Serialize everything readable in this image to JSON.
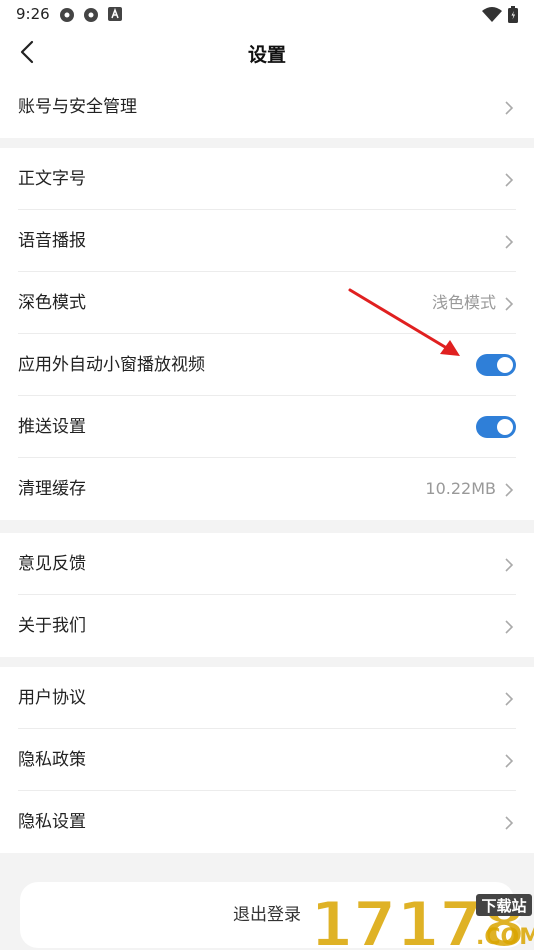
{
  "status": {
    "time": "9:26",
    "icons": [
      "gear-icon",
      "gear-icon",
      "text-a-icon",
      "wifi-icon",
      "battery-icon"
    ]
  },
  "header": {
    "title": "设置",
    "back_icon": "chevron-left-icon"
  },
  "sections": [
    [
      {
        "label": "账号与安全管理"
      }
    ],
    [
      {
        "label": "正文字号"
      },
      {
        "label": "语音播报"
      },
      {
        "label": "深色模式",
        "value": "浅色模式"
      },
      {
        "label": "应用外自动小窗播放视频",
        "toggle": true
      },
      {
        "label": "推送设置",
        "toggle": true
      },
      {
        "label": "清理缓存",
        "value": "10.22MB"
      }
    ],
    [
      {
        "label": "意见反馈"
      },
      {
        "label": "关于我们"
      }
    ],
    [
      {
        "label": "用户协议"
      },
      {
        "label": "隐私政策"
      },
      {
        "label": "隐私设置"
      }
    ]
  ],
  "logout": {
    "label": "退出登录"
  },
  "watermark": {
    "text": "17178",
    "badge": "下载站",
    "suffix": ".COM"
  },
  "colors": {
    "accent": "#2f7fd8",
    "arrow": "#e02020",
    "watermark": "#d9a400"
  }
}
